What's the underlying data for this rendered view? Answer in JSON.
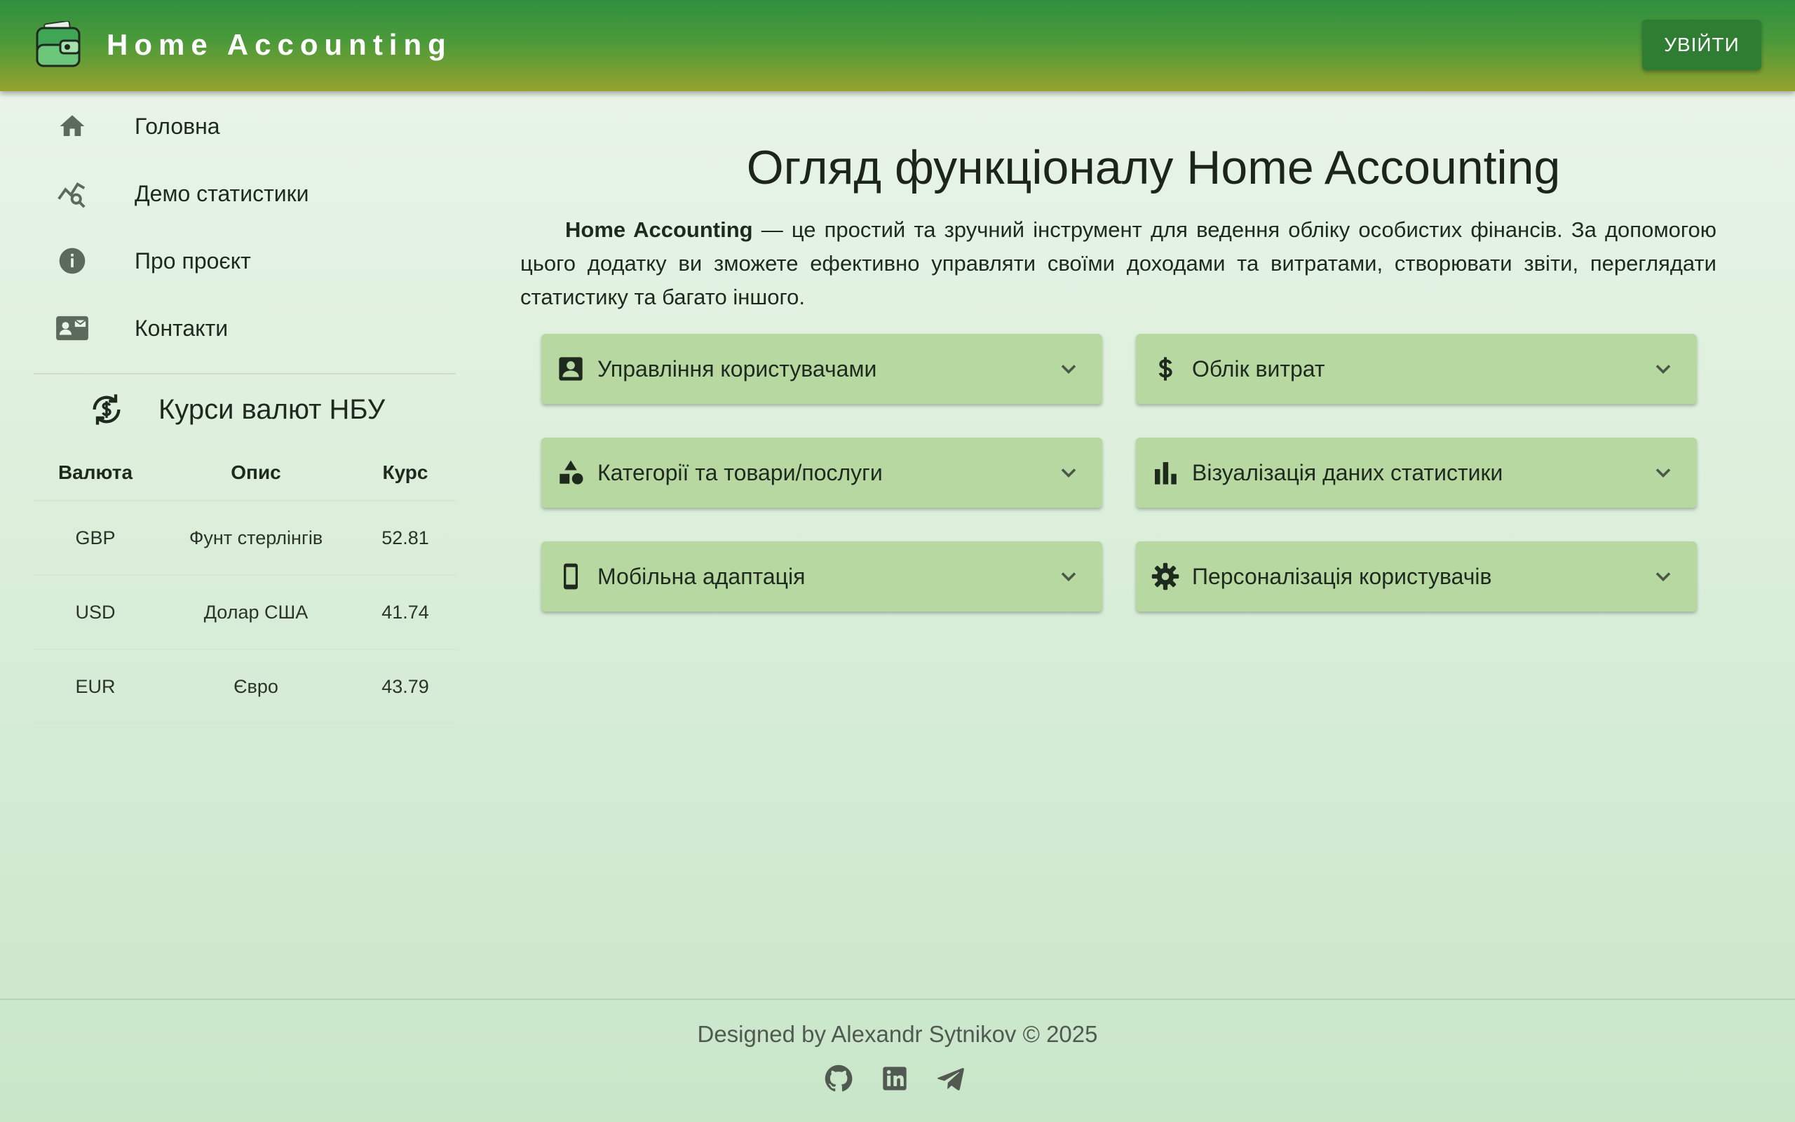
{
  "header": {
    "app_title": "Home Accounting",
    "login_label": "УВІЙТИ"
  },
  "sidebar": {
    "items": [
      {
        "label": "Головна",
        "icon": "home-icon"
      },
      {
        "label": "Демо статистики",
        "icon": "chart-search-icon"
      },
      {
        "label": "Про проєкт",
        "icon": "info-icon"
      },
      {
        "label": "Контакти",
        "icon": "contact-card-icon"
      }
    ]
  },
  "rates": {
    "title": "Курси валют НБУ",
    "icon": "currency-exchange-icon",
    "headers": [
      "Валюта",
      "Опис",
      "Курс"
    ],
    "rows": [
      [
        "GBP",
        "Фунт стерлінгів",
        "52.81"
      ],
      [
        "USD",
        "Долар США",
        "41.74"
      ],
      [
        "EUR",
        "Євро",
        "43.79"
      ]
    ]
  },
  "main": {
    "title": "Огляд функціоналу Home Accounting",
    "intro_bold": "Home Accounting",
    "intro_text": " — це простий та зручний інструмент для ведення обліку особистих фінансів. За допомогою цього додатку ви зможете ефективно управляти своїми доходами та витратами, створювати звіти, переглядати статистику та багато іншого.",
    "features": [
      {
        "label": "Управління користувачами",
        "icon": "account-box-icon"
      },
      {
        "label": "Облік витрат",
        "icon": "dollar-icon"
      },
      {
        "label": "Категорії та товари/послуги",
        "icon": "category-shapes-icon"
      },
      {
        "label": "Візуалізація даних статистики",
        "icon": "bar-chart-icon"
      },
      {
        "label": "Мобільна адаптація",
        "icon": "smartphone-icon"
      },
      {
        "label": "Персоналізація користувачів",
        "icon": "settings-gear-icon"
      }
    ]
  },
  "footer": {
    "credit": "Designed by Alexandr Sytnikov © 2025",
    "socials": [
      "github-icon",
      "linkedin-icon",
      "telegram-icon"
    ]
  },
  "colors": {
    "header_top": "#2f8f3f",
    "header_bottom": "#95a22d",
    "login_button": "#2e7d32",
    "card_bg": "#b8d8a2"
  }
}
